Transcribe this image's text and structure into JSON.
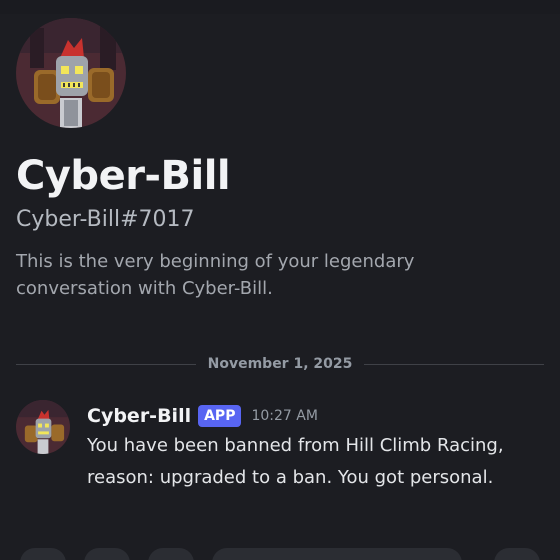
{
  "profile": {
    "display_name": "Cyber-Bill",
    "username": "Cyber-Bill#7017",
    "intro_text": "This is the very beginning of your legendary conversation with Cyber-Bill."
  },
  "divider": {
    "date": "November 1, 2025"
  },
  "message": {
    "author": "Cyber-Bill",
    "badge": "APP",
    "timestamp": "10:27 AM",
    "content": "You have been banned from Hill Climb Racing, reason: upgraded to a ban. You got personal."
  },
  "colors": {
    "background": "#1c1d22",
    "badge": "#5865f2",
    "avatar_background": "#4b2a33"
  },
  "icons": {
    "avatar": "robot-avatar"
  }
}
